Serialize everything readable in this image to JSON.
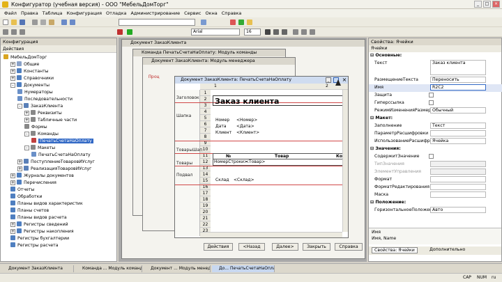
{
  "app": {
    "title": "Конфигуратор (учебная версия) - ООО \"МебельДомТорг\""
  },
  "menu": [
    "Файл",
    "Правка",
    "Таблица",
    "Конфигурация",
    "Отладка",
    "Администрирование",
    "Сервис",
    "Окна",
    "Справка"
  ],
  "toolbar": {
    "font": "Arial",
    "size": "16"
  },
  "left": {
    "header": "Конфигурация",
    "actions": "Действия",
    "tree": [
      {
        "t": "МебельДомТорг",
        "l": 0,
        "c": "#d9a520"
      },
      {
        "t": "Общие",
        "l": 1,
        "c": "#8aa2c8",
        "e": "+"
      },
      {
        "t": "Константы",
        "l": 1,
        "c": "#4f7fc0",
        "e": "+"
      },
      {
        "t": "Справочники",
        "l": 1,
        "c": "#4f7fc0",
        "e": "+"
      },
      {
        "t": "Документы",
        "l": 1,
        "c": "#4f7fc0",
        "e": "-"
      },
      {
        "t": "Нумераторы",
        "l": 2,
        "c": "#6a90c8"
      },
      {
        "t": "Последовательности",
        "l": 2,
        "c": "#6a90c8"
      },
      {
        "t": "ЗаказКлиента",
        "l": 2,
        "c": "#5a80b8",
        "e": "-"
      },
      {
        "t": "Реквизиты",
        "l": 3,
        "c": "#888",
        "e": "+"
      },
      {
        "t": "Табличные части",
        "l": 3,
        "c": "#888",
        "e": "+"
      },
      {
        "t": "Формы",
        "l": 3,
        "c": "#888"
      },
      {
        "t": "Команды",
        "l": 3,
        "c": "#888",
        "e": "-"
      },
      {
        "t": "ПечатьСчетаНаОплату",
        "l": 4,
        "c": "#c04040",
        "s": true
      },
      {
        "t": "Макеты",
        "l": 3,
        "c": "#888",
        "e": "-"
      },
      {
        "t": "ПечатьСчетаНаОплату",
        "l": 4,
        "c": "#6a90c8"
      },
      {
        "t": "ПоступлениеТоваровИУслуг",
        "l": 2,
        "c": "#5a80b8",
        "e": "+"
      },
      {
        "t": "РеализацияТоваровИУслуг",
        "l": 2,
        "c": "#5a80b8",
        "e": "+"
      },
      {
        "t": "Журналы документов",
        "l": 1,
        "c": "#4f7fc0",
        "e": "+"
      },
      {
        "t": "Перечисления",
        "l": 1,
        "c": "#4f7fc0",
        "e": "+"
      },
      {
        "t": "Отчеты",
        "l": 1,
        "c": "#4f7fc0"
      },
      {
        "t": "Обработки",
        "l": 1,
        "c": "#4f7fc0"
      },
      {
        "t": "Планы видов характеристик",
        "l": 1,
        "c": "#4f7fc0"
      },
      {
        "t": "Планы счетов",
        "l": 1,
        "c": "#4f7fc0"
      },
      {
        "t": "Планы видов расчета",
        "l": 1,
        "c": "#4f7fc0"
      },
      {
        "t": "Регистры сведений",
        "l": 1,
        "c": "#4f7fc0",
        "e": "+"
      },
      {
        "t": "Регистры накопления",
        "l": 1,
        "c": "#4f7fc0",
        "e": "+"
      },
      {
        "t": "Регистры бухгалтерии",
        "l": 1,
        "c": "#4f7fc0"
      },
      {
        "t": "Регистры расчета",
        "l": 1,
        "c": "#4f7fc0"
      }
    ]
  },
  "windows": {
    "w1": "Документ ЗаказКлиента",
    "w2": "Команда ПечатьСчетаНаОплату: Модуль команды",
    "w3": "Документ ЗаказКлиента: Модуль менеджера",
    "w4": "Документ ЗаказКлиента: ПечатьСчетаНаОплату",
    "code": "Проц"
  },
  "sheet": {
    "cols": [
      "1",
      "2"
    ],
    "areas": [
      "Заголовок",
      "Шапка",
      "ТоварыШап",
      "Товары",
      "Подвал"
    ],
    "title": "Заказ клиента",
    "f_num": "Номер",
    "v_num": "<Номер>",
    "f_date": "Дата",
    "v_date": "<Дата>",
    "f_client": "Клиент",
    "v_client": "<Клиент>",
    "th_n": "№",
    "th_goods": "Товар",
    "th_k": "Ко",
    "v_row": "НомерСтроки>",
    "v_goods": "<Товар>",
    "f_store": "Склад",
    "v_store": "<Склад>"
  },
  "buttons": {
    "actions": "Действия",
    "back": "<Назад",
    "next": "Далее>",
    "close": "Закрыть",
    "help": "Справка"
  },
  "props": {
    "header": "Свойства: Ячейки",
    "sub": "Ячейки",
    "rows": [
      {
        "k": "grp",
        "n": "Основные:"
      },
      {
        "n": "Текст",
        "v": "Заказ клиента",
        "tall": true
      },
      {
        "n": "РазмещениеТекста",
        "v": "Переносить"
      },
      {
        "n": "Имя",
        "v": "R2C2",
        "hl": true
      },
      {
        "n": "Защита",
        "chk": true
      },
      {
        "n": "Гиперссылка",
        "chk": true
      },
      {
        "n": "РежимИзмененияРазмера",
        "v": "Обычный"
      },
      {
        "k": "grp",
        "n": "Макет:"
      },
      {
        "n": "Заполнение",
        "v": "Текст"
      },
      {
        "n": "ПараметрРасшифровки",
        "v": ""
      },
      {
        "n": "ИспользованиеРасшифровки",
        "v": "Ячейка"
      },
      {
        "k": "grp",
        "n": "Значения:"
      },
      {
        "n": "СодержитЗначение",
        "chk": true
      },
      {
        "n": "ТипЗначения",
        "v": "",
        "dis": true
      },
      {
        "n": "ЭлементУправления",
        "v": "",
        "dis": true
      },
      {
        "n": "Формат",
        "v": ""
      },
      {
        "n": "ФорматРедактирования",
        "v": ""
      },
      {
        "n": "Маска",
        "v": ""
      },
      {
        "k": "grp",
        "n": "Положение:"
      },
      {
        "n": "ГоризонтальноеПоложение",
        "v": "Авто"
      }
    ],
    "desc1": "Имя",
    "desc2": "Имя, Name",
    "tab1": "Свойства: Ячейки",
    "tab2": "Дополнительно"
  },
  "tasks": [
    "Документ ЗаказКлиента",
    "Команда ... Модуль команды",
    "Документ ... Модуль менеджера",
    "До... ПечатьСчетаНаОплату"
  ],
  "status": {
    "cap": "CAP",
    "num": "NUM",
    "lang": "ru"
  }
}
